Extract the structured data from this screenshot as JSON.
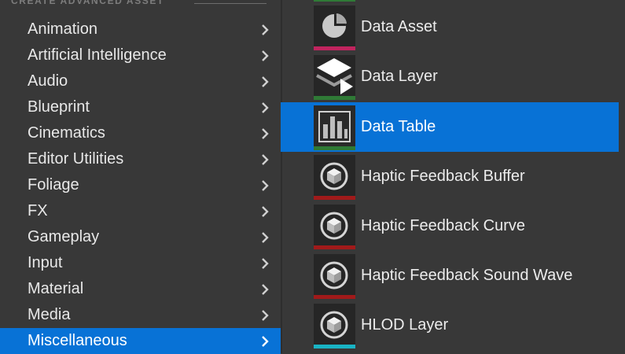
{
  "left_panel": {
    "header": "CREATE ADVANCED ASSET",
    "categories": [
      {
        "label": "Animation"
      },
      {
        "label": "Artificial Intelligence"
      },
      {
        "label": "Audio"
      },
      {
        "label": "Blueprint"
      },
      {
        "label": "Cinematics"
      },
      {
        "label": "Editor Utilities"
      },
      {
        "label": "Foliage"
      },
      {
        "label": "FX"
      },
      {
        "label": "Gameplay"
      },
      {
        "label": "Input"
      },
      {
        "label": "Material"
      },
      {
        "label": "Media"
      },
      {
        "label": "Miscellaneous"
      }
    ],
    "selected_category": "Miscellaneous"
  },
  "right_panel": {
    "assets": [
      {
        "label": "Data Asset",
        "icon": "pie-chart-icon",
        "color": "#c0245e"
      },
      {
        "label": "Data Layer",
        "icon": "layers-icon",
        "color": "#2f7a36"
      },
      {
        "label": "Data Table",
        "icon": "bar-chart-icon",
        "color": "#2f7a36"
      },
      {
        "label": "Haptic Feedback Buffer",
        "icon": "cube-icon",
        "color": "#a11a1a"
      },
      {
        "label": "Haptic Feedback Curve",
        "icon": "cube-icon",
        "color": "#a11a1a"
      },
      {
        "label": "Haptic Feedback Sound Wave",
        "icon": "cube-icon",
        "color": "#a11a1a"
      },
      {
        "label": "HLOD Layer",
        "icon": "cube-icon",
        "color": "#19b3c4"
      }
    ],
    "selected_asset": "Data Table"
  },
  "colors": {
    "background": "#383838",
    "selection": "#0872d6",
    "thumbnail": "#262626"
  }
}
